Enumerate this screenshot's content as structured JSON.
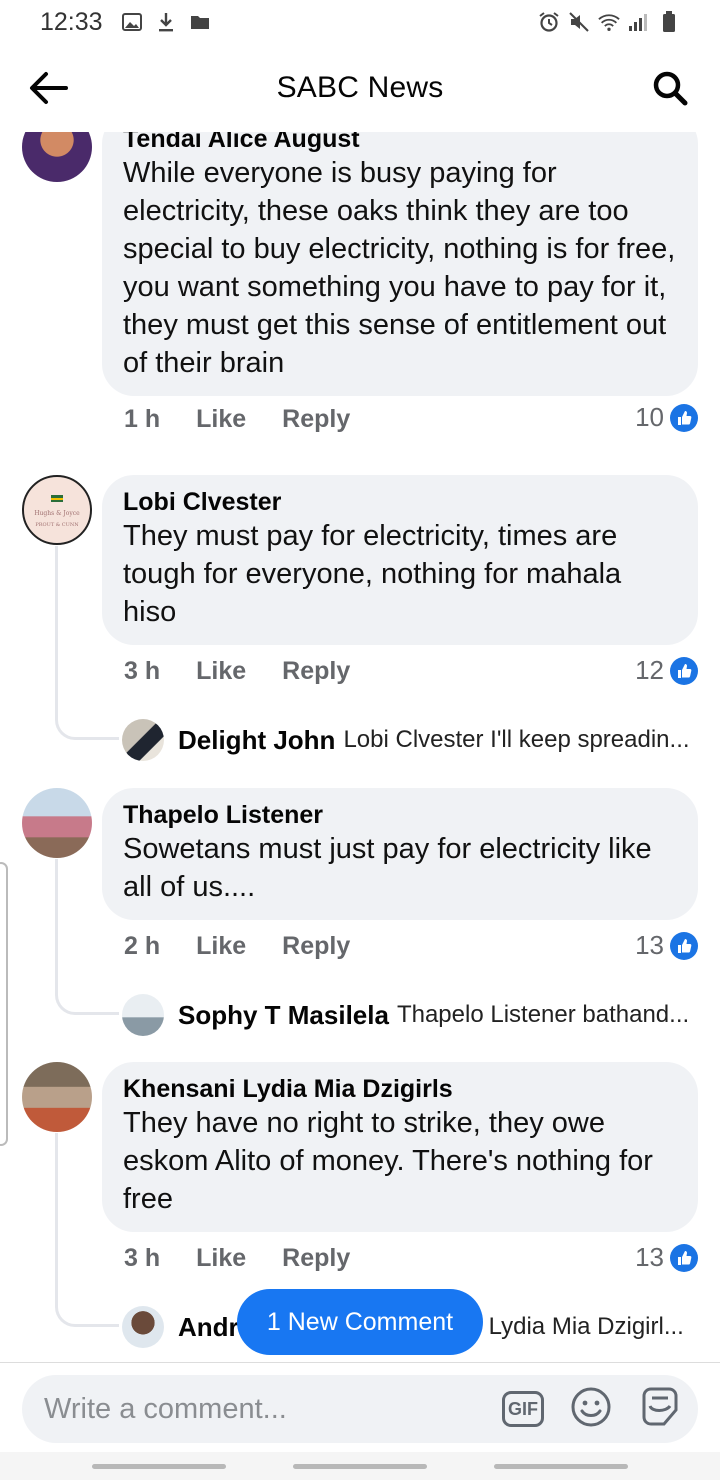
{
  "status_bar": {
    "time": "12:33"
  },
  "header": {
    "title": "SABC News"
  },
  "comments": [
    {
      "author": "Tendai Alice August",
      "text": "While everyone is busy paying for electricity, these oaks think they are too special to buy electricity, nothing is for free, you want something you have to pay for it, they must get this sense of entitlement out of their brain",
      "time": "1 h",
      "like_label": "Like",
      "reply_label": "Reply",
      "reactions": "10"
    },
    {
      "author": "Lobi Clvester",
      "text": "They must pay for electricity, times are tough for everyone, nothing for mahala hiso",
      "time": "3 h",
      "like_label": "Like",
      "reply_label": "Reply",
      "reactions": "12",
      "reply": {
        "author": "Delight John",
        "snippet": "Lobi Clvester  I'll keep spreadin..."
      }
    },
    {
      "author": "Thapelo Listener",
      "text": "Sowetans must just pay for electricity like all of us....",
      "time": "2 h",
      "like_label": "Like",
      "reply_label": "Reply",
      "reactions": "13",
      "reply": {
        "author": "Sophy T Masilela",
        "snippet": "Thapelo Listener bathand..."
      }
    },
    {
      "author": "Khensani Lydia Mia Dzigirls",
      "text": "They have no right to strike, they owe eskom Alito of money. There's nothing for free",
      "time": "3 h",
      "like_label": "Like",
      "reply_label": "Reply",
      "reactions": "13",
      "reply": {
        "author": "Andr",
        "snippet": "i Lydia Mia Dzigirl..."
      }
    }
  ],
  "new_comment_pill": "1 New Comment",
  "composer": {
    "placeholder": "Write a comment...",
    "gif_label": "GIF"
  },
  "colors": {
    "accent": "#1877f2",
    "bubble": "#f0f2f5",
    "muted": "#65676b"
  }
}
